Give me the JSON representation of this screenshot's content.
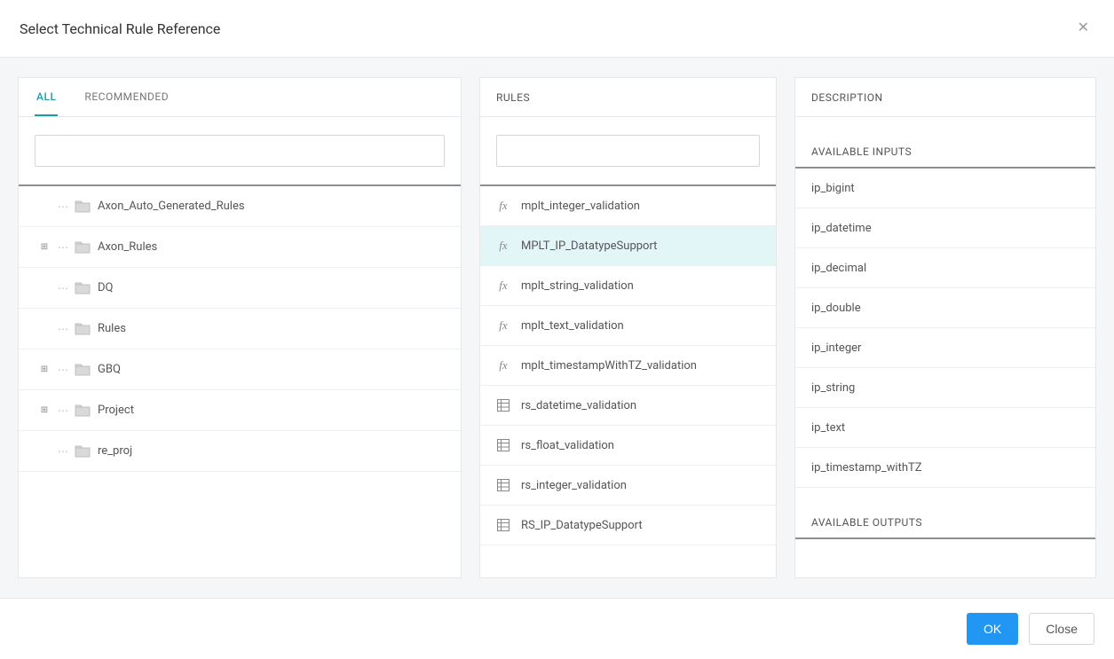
{
  "header": {
    "title": "Select Technical Rule Reference"
  },
  "tabs": {
    "all": "ALL",
    "recommended": "RECOMMENDED",
    "active": "all"
  },
  "tree": {
    "items": [
      {
        "label": "Axon_Auto_Generated_Rules",
        "expandable": false
      },
      {
        "label": "Axon_Rules",
        "expandable": true
      },
      {
        "label": "DQ",
        "expandable": false
      },
      {
        "label": "Rules",
        "expandable": false
      },
      {
        "label": "GBQ",
        "expandable": true
      },
      {
        "label": "Project",
        "expandable": true
      },
      {
        "label": "re_proj",
        "expandable": false
      }
    ]
  },
  "rules": {
    "header": "RULES",
    "items": [
      {
        "label": "mplt_integer_validation",
        "icon": "fx",
        "selected": false
      },
      {
        "label": "MPLT_IP_DatatypeSupport",
        "icon": "fx",
        "selected": true
      },
      {
        "label": "mplt_string_validation",
        "icon": "fx",
        "selected": false
      },
      {
        "label": "mplt_text_validation",
        "icon": "fx",
        "selected": false
      },
      {
        "label": "mplt_timestampWithTZ_validation",
        "icon": "fx",
        "selected": false
      },
      {
        "label": "rs_datetime_validation",
        "icon": "grid",
        "selected": false
      },
      {
        "label": "rs_float_validation",
        "icon": "grid",
        "selected": false
      },
      {
        "label": "rs_integer_validation",
        "icon": "grid",
        "selected": false
      },
      {
        "label": "RS_IP_DatatypeSupport",
        "icon": "grid",
        "selected": false
      }
    ]
  },
  "description": {
    "header": "DESCRIPTION",
    "inputs_title": "AVAILABLE INPUTS",
    "outputs_title": "AVAILABLE OUTPUTS",
    "inputs": [
      "ip_bigint",
      "ip_datetime",
      "ip_decimal",
      "ip_double",
      "ip_integer",
      "ip_string",
      "ip_text",
      "ip_timestamp_withTZ"
    ]
  },
  "footer": {
    "ok": "OK",
    "close": "Close"
  }
}
